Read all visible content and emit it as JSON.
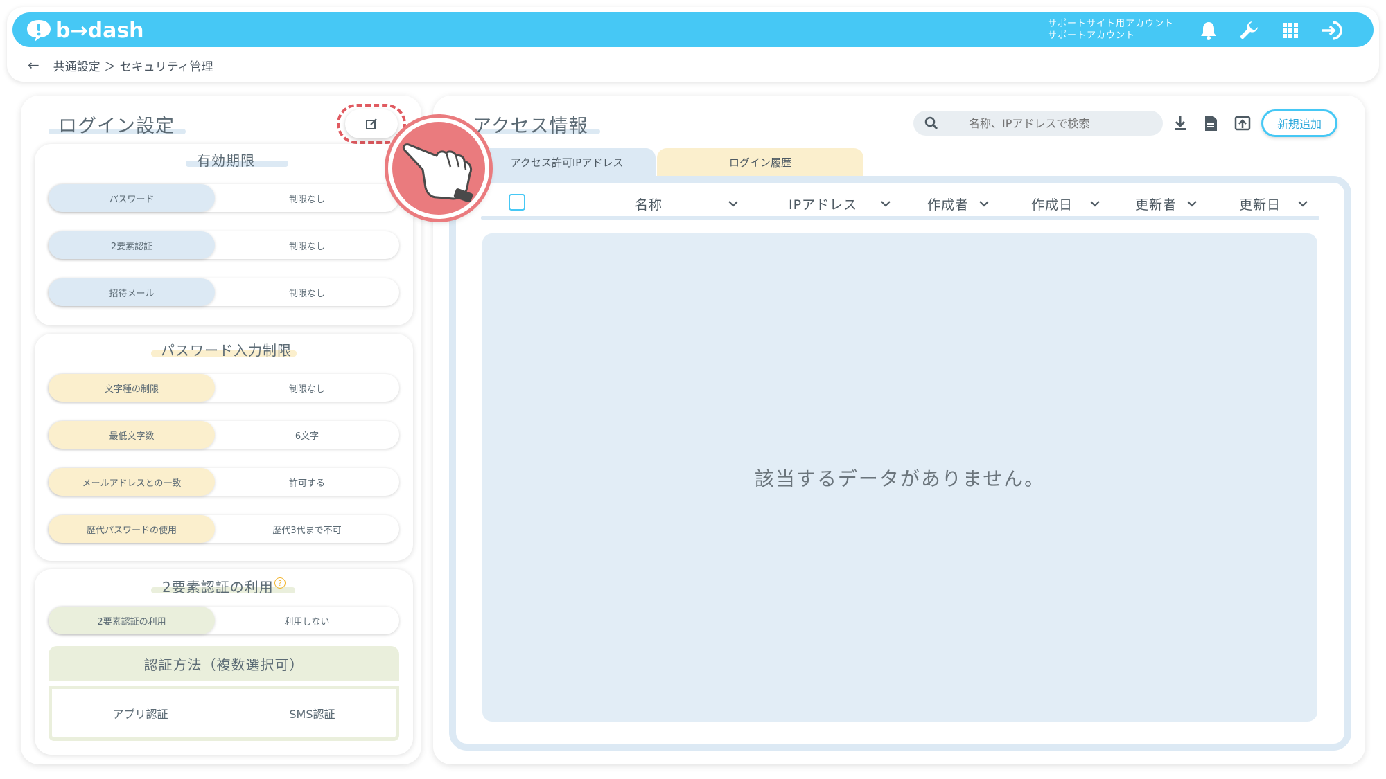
{
  "header": {
    "logo_text": "b→dash",
    "account_line1": "サポートサイト用アカウント",
    "account_line2": "サポートアカウント",
    "icons": [
      "bell-icon",
      "wrench-icon",
      "grid-icon",
      "logout-icon"
    ],
    "accent_color": "#46c8f5"
  },
  "breadcrumb": {
    "back": "←",
    "path": "共通設定 ＞ セキュリティ管理"
  },
  "login_settings": {
    "title": "ログイン設定",
    "expiry": {
      "title": "有効期限",
      "rows": [
        {
          "label": "パスワード",
          "value": "制限なし"
        },
        {
          "label": "2要素認証",
          "value": "制限なし"
        },
        {
          "label": "招待メール",
          "value": "制限なし"
        }
      ]
    },
    "password_rules": {
      "title": "パスワード入力制限",
      "rows": [
        {
          "label": "文字種の制限",
          "value": "制限なし"
        },
        {
          "label": "最低文字数",
          "value": "6文字"
        },
        {
          "label": "メールアドレスとの一致",
          "value": "許可する"
        },
        {
          "label": "歴代パスワードの使用",
          "value": "歴代3代まで不可"
        }
      ]
    },
    "two_factor": {
      "title": "2要素認証の利用",
      "rows": [
        {
          "label": "2要素認証の利用",
          "value": "利用しない"
        }
      ],
      "method_title": "認証方法（複数選択可）",
      "methods": [
        "アプリ認証",
        "SMS認証"
      ]
    }
  },
  "access_info": {
    "title": "アクセス情報",
    "search_placeholder": "名称、IPアドレスで検索",
    "new_button": "新規追加",
    "tabs": [
      "アクセス許可IPアドレス",
      "ログイン履歴"
    ],
    "columns": [
      "名称",
      "IPアドレス",
      "作成者",
      "作成日",
      "更新者",
      "更新日"
    ],
    "empty_message": "該当するデータがありません。"
  }
}
